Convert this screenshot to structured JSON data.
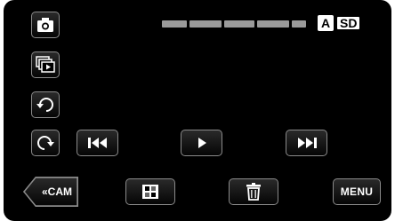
{
  "status": {
    "storage_badge_a": "A",
    "storage_badge_sd": "SD"
  },
  "buttons": {
    "cam_label": "«CAM",
    "menu_label": "MENU"
  },
  "icons": {
    "camera": "camera-icon",
    "slideshow": "slideshow-icon",
    "rotate_left": "rotate-left-icon",
    "rotate_right": "rotate-right-icon",
    "previous": "skip-previous-icon",
    "play": "play-icon",
    "next": "skip-next-icon",
    "index": "index-grid-icon",
    "delete": "trash-icon"
  },
  "colors": {
    "background": "#000000",
    "button_border": "#8a8a8a",
    "text": "#ffffff"
  }
}
